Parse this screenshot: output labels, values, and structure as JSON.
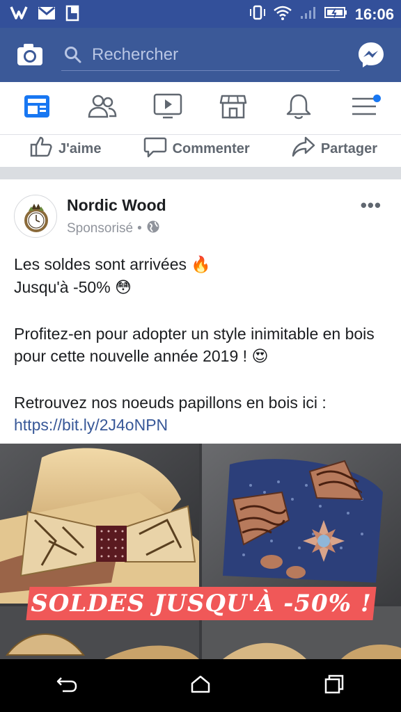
{
  "status_bar": {
    "time": "16:06",
    "left_icons": [
      "vivo-icon",
      "gmail-icon",
      "sim-icon"
    ],
    "right_icons": [
      "vibrate-icon",
      "wifi-icon",
      "signal-icon",
      "battery-icon"
    ]
  },
  "app_bar": {
    "search_placeholder": "Rechercher",
    "camera_icon": "camera-icon",
    "messenger_icon": "messenger-icon",
    "color": "#3b5998"
  },
  "nav_tabs": [
    {
      "icon": "news-feed-icon",
      "active": true
    },
    {
      "icon": "friends-icon",
      "active": false
    },
    {
      "icon": "watch-icon",
      "active": false
    },
    {
      "icon": "marketplace-icon",
      "active": false
    },
    {
      "icon": "notifications-icon",
      "active": false
    },
    {
      "icon": "menu-icon",
      "active": false,
      "badge": true
    }
  ],
  "actions": {
    "like": "J'aime",
    "comment": "Commenter",
    "share": "Partager"
  },
  "post": {
    "page_name": "Nordic Wood",
    "sponsored": "Sponsorisé",
    "dot": "•",
    "more": "•••",
    "line1": "Les soldes sont arrivées",
    "line1_emoji": "🔥",
    "line2": "Jusqu'à -50%",
    "line2_emoji": "😳",
    "para2": "Profitez-en pour adopter un style inimitable en bois pour cette nouvelle année 2019 !",
    "para2_emoji": "😍",
    "para3": "Retrouvez nos noeuds papillons en bois ici :",
    "link": "https://bit.ly/2J4oNPN",
    "banner": "SOLDES JUSQU'À -50% !"
  },
  "sys_nav": {
    "back_icon": "back-icon",
    "home_icon": "home-icon",
    "recents_icon": "recents-icon"
  }
}
